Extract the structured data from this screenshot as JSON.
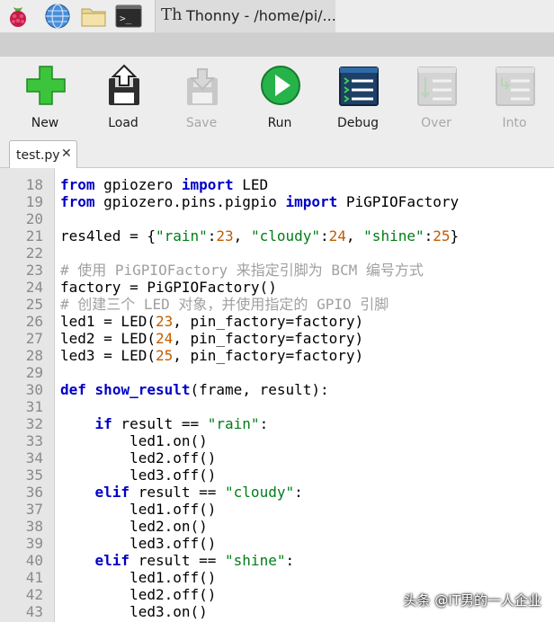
{
  "taskbar": {
    "window_title": "Thonny  -  /home/pi/..."
  },
  "toolbar": {
    "items": [
      {
        "label": "New",
        "icon": "new-file-icon",
        "enabled": true
      },
      {
        "label": "Load",
        "icon": "load-icon",
        "enabled": true
      },
      {
        "label": "Save",
        "icon": "save-icon",
        "enabled": false
      },
      {
        "label": "Run",
        "icon": "run-icon",
        "enabled": true
      },
      {
        "label": "Debug",
        "icon": "debug-icon",
        "enabled": true
      },
      {
        "label": "Over",
        "icon": "step-over-icon",
        "enabled": false
      },
      {
        "label": "Into",
        "icon": "step-into-icon",
        "enabled": false
      }
    ]
  },
  "tabs": [
    {
      "label": "test.py",
      "close": "✕"
    }
  ],
  "editor": {
    "lines": [
      {
        "n": "18",
        "tokens": [
          [
            "kw",
            "from"
          ],
          [
            "t",
            " gpiozero "
          ],
          [
            "kw",
            "import"
          ],
          [
            "t",
            " LED"
          ]
        ]
      },
      {
        "n": "19",
        "tokens": [
          [
            "kw",
            "from"
          ],
          [
            "t",
            " gpiozero.pins.pigpio "
          ],
          [
            "kw",
            "import"
          ],
          [
            "t",
            " PiGPIOFactory"
          ]
        ]
      },
      {
        "n": "20",
        "tokens": []
      },
      {
        "n": "21",
        "tokens": [
          [
            "t",
            "res4led = {"
          ],
          [
            "str",
            "\"rain\""
          ],
          [
            "t",
            ":"
          ],
          [
            "num",
            "23"
          ],
          [
            "t",
            ", "
          ],
          [
            "str",
            "\"cloudy\""
          ],
          [
            "t",
            ":"
          ],
          [
            "num",
            "24"
          ],
          [
            "t",
            ", "
          ],
          [
            "str",
            "\"shine\""
          ],
          [
            "t",
            ":"
          ],
          [
            "num",
            "25"
          ],
          [
            "t",
            "}"
          ]
        ]
      },
      {
        "n": "22",
        "tokens": []
      },
      {
        "n": "23",
        "tokens": [
          [
            "cmt",
            "# 使用 PiGPIOFactory 来指定引脚为 BCM 编号方式"
          ]
        ]
      },
      {
        "n": "24",
        "tokens": [
          [
            "t",
            "factory = PiGPIOFactory()"
          ]
        ]
      },
      {
        "n": "25",
        "tokens": [
          [
            "cmt",
            "# 创建三个 LED 对象，并使用指定的 GPIO 引脚"
          ]
        ]
      },
      {
        "n": "26",
        "tokens": [
          [
            "t",
            "led1 = LED("
          ],
          [
            "num",
            "23"
          ],
          [
            "t",
            ", pin_factory=factory)"
          ]
        ]
      },
      {
        "n": "27",
        "tokens": [
          [
            "t",
            "led2 = LED("
          ],
          [
            "num",
            "24"
          ],
          [
            "t",
            ", pin_factory=factory)"
          ]
        ]
      },
      {
        "n": "28",
        "tokens": [
          [
            "t",
            "led3 = LED("
          ],
          [
            "num",
            "25"
          ],
          [
            "t",
            ", pin_factory=factory)"
          ]
        ]
      },
      {
        "n": "29",
        "tokens": []
      },
      {
        "n": "30",
        "tokens": [
          [
            "kw",
            "def"
          ],
          [
            "t",
            " "
          ],
          [
            "fn",
            "show_result"
          ],
          [
            "t",
            "(frame, result):"
          ]
        ]
      },
      {
        "n": "31",
        "tokens": []
      },
      {
        "n": "32",
        "tokens": [
          [
            "t",
            "    "
          ],
          [
            "kw",
            "if"
          ],
          [
            "t",
            " result == "
          ],
          [
            "str",
            "\"rain\""
          ],
          [
            "t",
            ":"
          ]
        ]
      },
      {
        "n": "33",
        "tokens": [
          [
            "t",
            "        led1.on()"
          ]
        ]
      },
      {
        "n": "34",
        "tokens": [
          [
            "t",
            "        led2.off()"
          ]
        ]
      },
      {
        "n": "35",
        "tokens": [
          [
            "t",
            "        led3.off()"
          ]
        ]
      },
      {
        "n": "36",
        "tokens": [
          [
            "t",
            "    "
          ],
          [
            "kw",
            "elif"
          ],
          [
            "t",
            " result == "
          ],
          [
            "str",
            "\"cloudy\""
          ],
          [
            "t",
            ":"
          ]
        ]
      },
      {
        "n": "37",
        "tokens": [
          [
            "t",
            "        led1.off()"
          ]
        ]
      },
      {
        "n": "38",
        "tokens": [
          [
            "t",
            "        led2.on()"
          ]
        ]
      },
      {
        "n": "39",
        "tokens": [
          [
            "t",
            "        led3.off()"
          ]
        ]
      },
      {
        "n": "40",
        "tokens": [
          [
            "t",
            "    "
          ],
          [
            "kw",
            "elif"
          ],
          [
            "t",
            " result == "
          ],
          [
            "str",
            "\"shine\""
          ],
          [
            "t",
            ":"
          ]
        ]
      },
      {
        "n": "41",
        "tokens": [
          [
            "t",
            "        led1.off()"
          ]
        ]
      },
      {
        "n": "42",
        "tokens": [
          [
            "t",
            "        led2.off()"
          ]
        ]
      },
      {
        "n": "43",
        "tokens": [
          [
            "t",
            "        led3.on()"
          ]
        ]
      }
    ]
  },
  "watermark": "头条 @IT男的一人企业",
  "colors": {
    "keyword": "#0000c8",
    "string": "#007d18",
    "number": "#c15d00",
    "comment": "#a0a0a0",
    "run_green": "#26b34a",
    "new_green": "#3cc43c"
  }
}
